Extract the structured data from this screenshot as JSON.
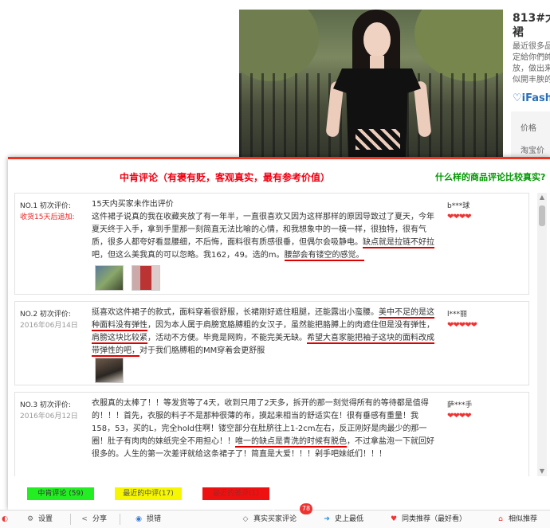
{
  "product": {
    "title": "813#大\n裙",
    "desc": "最近很多品\n定給你們帥\n放，做出来\n似開丰腴的",
    "brand": "iFash",
    "price_label": "价格",
    "tb_price_label": "淘宝价"
  },
  "modal": {
    "title": "中肯评论（有褒有贬，客观真实，最有参考价值）",
    "link": "什么样的商品评论比较真实?"
  },
  "reviews": [
    {
      "no": "NO.1 初次评价:",
      "date": "收货15天后追加:",
      "date_red": true,
      "segments": [
        {
          "t": "15天内买家未作出评价",
          "u": false,
          "br": true
        },
        {
          "t": "这件裙子说真的我在收藏夹放了有一年半，一直很喜欢又因为这样那样的原因导致过了夏天，今年夏天终于入手，拿到手里那一刻简直无法比喻的心情，和我想象中的一模一样，很独特，很有气质，很多人都夸好看显腰细，不后悔，面料很有质感很垂，但偶尔会吸静电。",
          "u": false
        },
        {
          "t": "缺点就是拉链不好拉",
          "u": true
        },
        {
          "t": "吧，但这么美我真的可以忽略。我162，49。选的m。",
          "u": false
        },
        {
          "t": "腰部会有镂空的感觉。",
          "u": true
        }
      ],
      "user": "b***球",
      "hearts": "❤❤❤❤"
    },
    {
      "no": "NO.2 初次评价:",
      "date": "2016年06月14日",
      "date_red": false,
      "segments": [
        {
          "t": "挺喜欢这件裙子的款式，面料穿着很舒服，长裙刚好遮住粗腿，还能露出小蛮腰。",
          "u": false
        },
        {
          "t": "美中不足的是这种面料没有弹性",
          "u": true
        },
        {
          "t": "，因为本人属于肩膀宽胳膊粗的女汉子，虽然能把胳膊上的肉遮住但是没有弹性，",
          "u": false
        },
        {
          "t": "肩膀这块比较紧",
          "u": true
        },
        {
          "t": "，活动不方便。毕竟是网购，不能完美无缺。",
          "u": false
        },
        {
          "t": "希望大喜家能把袖子这块的面料改成带弹性的吧，",
          "u": true
        },
        {
          "t": "对于我们胳膊粗的MM穿着会更舒服",
          "u": false
        }
      ],
      "user": "l***丽",
      "hearts": "❤❤❤❤❤"
    },
    {
      "no": "NO.3 初次评价:",
      "date": "2016年06月12日",
      "date_red": false,
      "segments": [
        {
          "t": "衣服真的太棒了！！等发货等了4天，收到只用了2天多，拆开的那一刻觉得所有的等待都是值得的！！！首先，衣服的料子不是那种很薄的布，摸起来相当的舒适实在！很有垂感有重量！我158，53，买的L，完全hold住啊！镂空部分在肚脐往上1-2cm左右，反正刚好是肉最少的那一圈！肚子有肉肉的妹纸完全不用担心！！",
          "u": false
        },
        {
          "t": "唯一的缺点是青洗的时候有脱色",
          "u": true
        },
        {
          "t": "，不过拿盐泡一下就回好很多的。人生的第一次差评就给这条裙子了！简直是大爱！！！剁手吧妹纸们！！！",
          "u": false
        }
      ],
      "user": "萨***手",
      "hearts": "❤❤❤❤"
    }
  ],
  "tabs": [
    {
      "label": "中肯评论 (59)",
      "bg": "#22ee22",
      "color": "#333"
    },
    {
      "label": "最近的中评(17)",
      "bg": "#f6f600",
      "color": "#555"
    },
    {
      "label": "最近的差评(1)",
      "bg": "#ee1111",
      "color": "#aa2222"
    }
  ],
  "bottombar": {
    "settings": "设置",
    "share": "分享",
    "hide": "损错",
    "real_review": "真实买家评论",
    "badge": "78",
    "history_low": "史上最低",
    "same_rec": "同类推荐（最好看）",
    "similar": "相似推荐"
  },
  "colors": {
    "accent": "#ee2222",
    "green": "#009900"
  }
}
